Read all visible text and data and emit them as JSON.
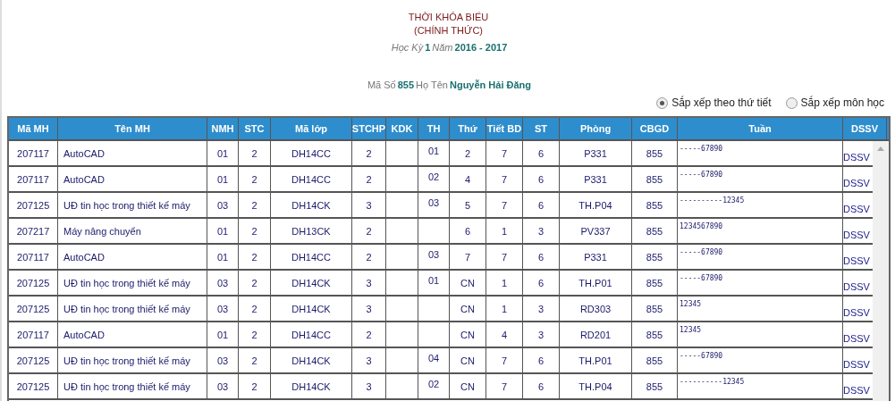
{
  "header": {
    "title": "THỜI KHÓA BIỂU",
    "subtitle": "(CHÍNH THỨC)",
    "term_label": "Học Kỳ",
    "term": "1",
    "year_label": "Năm",
    "year": "2016 - 2017"
  },
  "lecturer": {
    "id_label": "Mã Số",
    "id": "855",
    "name_label": "Họ Tên",
    "name": "Nguyễn Hải Đăng"
  },
  "sort_options": [
    {
      "label": "Sắp xếp theo thứ tiết",
      "selected": true
    },
    {
      "label": "Sắp xếp môn học",
      "selected": false
    }
  ],
  "table": {
    "columns": [
      {
        "label": "Mã MH",
        "kind": "center"
      },
      {
        "label": "Tên MH",
        "kind": "left"
      },
      {
        "label": "NMH",
        "kind": "center"
      },
      {
        "label": "STC",
        "kind": "center"
      },
      {
        "label": "Mã lớp",
        "kind": "center"
      },
      {
        "label": "STCHP",
        "kind": "center"
      },
      {
        "label": "KDK",
        "kind": "center"
      },
      {
        "label": "TH",
        "kind": "top"
      },
      {
        "label": "Thứ",
        "kind": "center"
      },
      {
        "label": "Tiết BD",
        "kind": "center"
      },
      {
        "label": "ST",
        "kind": "center"
      },
      {
        "label": "Phòng",
        "kind": "center"
      },
      {
        "label": "CBGD",
        "kind": "center"
      },
      {
        "label": "Tuần",
        "kind": "weeks"
      },
      {
        "label": "DSSV",
        "kind": "link"
      }
    ],
    "rows": [
      [
        "207117",
        "AutoCAD",
        "01",
        "2",
        "DH14CC",
        "2",
        "",
        "01",
        "2",
        "7",
        "6",
        "P331",
        "855",
        "-----67890",
        "DSSV"
      ],
      [
        "207117",
        "AutoCAD",
        "01",
        "2",
        "DH14CC",
        "2",
        "",
        "02",
        "4",
        "7",
        "6",
        "P331",
        "855",
        "-----67890",
        "DSSV"
      ],
      [
        "207125",
        "UĐ tin học trong thiết kế máy",
        "03",
        "2",
        "DH14CK",
        "3",
        "",
        "03",
        "5",
        "7",
        "6",
        "TH.P04",
        "855",
        "----------12345",
        "DSSV"
      ],
      [
        "207217",
        "Máy nâng chuyển",
        "01",
        "2",
        "DH13CK",
        "2",
        "",
        "",
        "6",
        "1",
        "3",
        "PV337",
        "855",
        "1234567890",
        "DSSV"
      ],
      [
        "207117",
        "AutoCAD",
        "01",
        "2",
        "DH14CC",
        "2",
        "",
        "03",
        "7",
        "7",
        "6",
        "P331",
        "855",
        "-----67890",
        "DSSV"
      ],
      [
        "207125",
        "UĐ tin học trong thiết kế máy",
        "03",
        "2",
        "DH14CK",
        "3",
        "",
        "01",
        "CN",
        "1",
        "6",
        "TH.P01",
        "855",
        "-----67890",
        "DSSV"
      ],
      [
        "207125",
        "UĐ tin học trong thiết kế máy",
        "03",
        "2",
        "DH14CK",
        "3",
        "",
        "",
        "CN",
        "1",
        "3",
        "RD303",
        "855",
        "12345",
        "DSSV"
      ],
      [
        "207117",
        "AutoCAD",
        "01",
        "2",
        "DH14CC",
        "2",
        "",
        "",
        "CN",
        "4",
        "3",
        "RD201",
        "855",
        "12345",
        "DSSV"
      ],
      [
        "207125",
        "UĐ tin học trong thiết kế máy",
        "03",
        "2",
        "DH14CK",
        "3",
        "",
        "04",
        "CN",
        "7",
        "6",
        "TH.P01",
        "855",
        "-----67890",
        "DSSV"
      ],
      [
        "207125",
        "UĐ tin học trong thiết kế máy",
        "03",
        "2",
        "DH14CK",
        "3",
        "",
        "02",
        "CN",
        "7",
        "6",
        "TH.P04",
        "855",
        "----------12345",
        "DSSV"
      ]
    ]
  }
}
